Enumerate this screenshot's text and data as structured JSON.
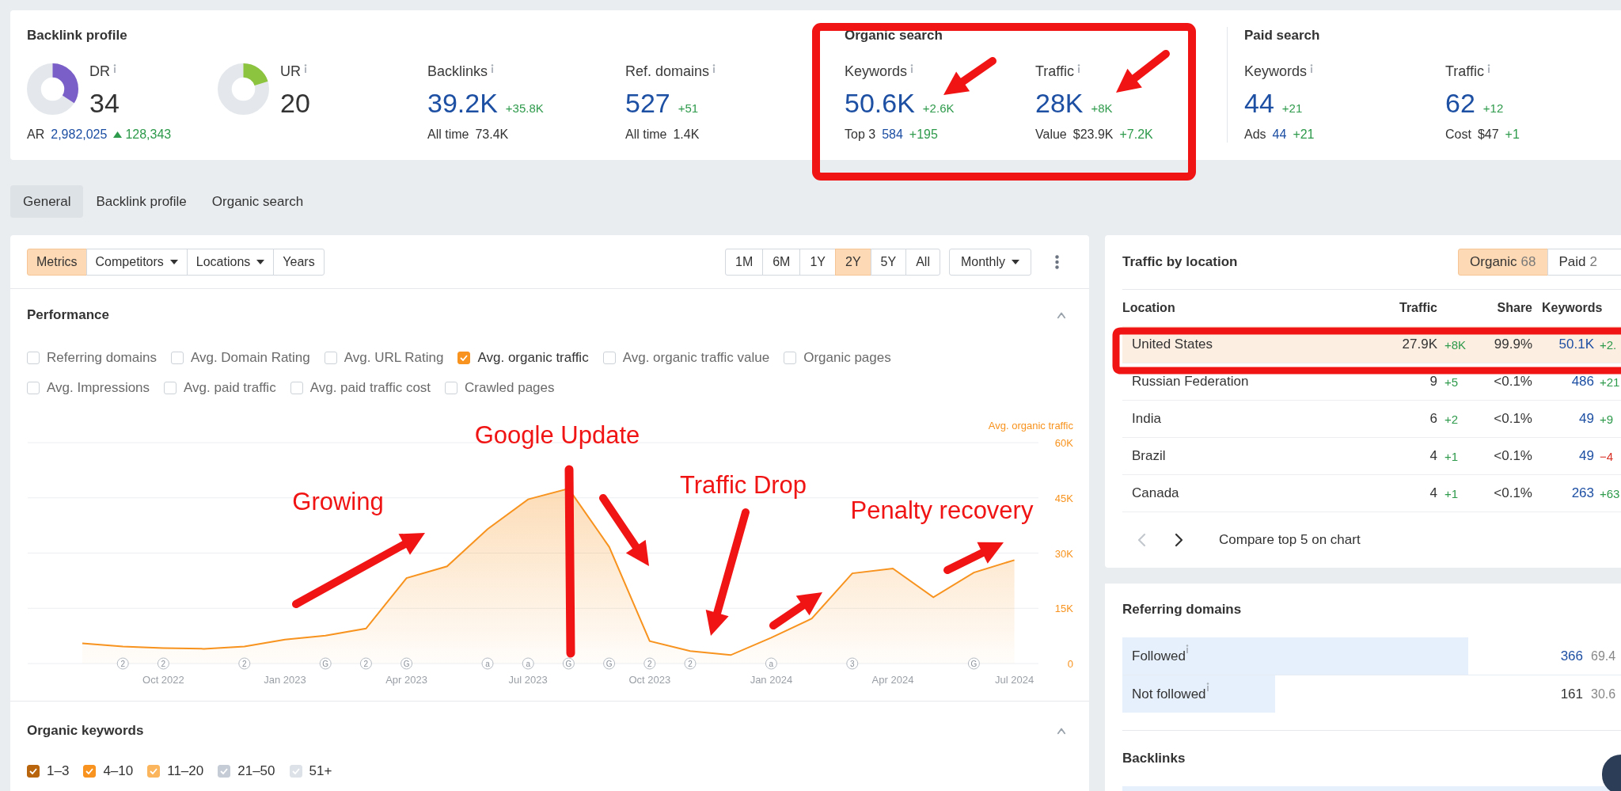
{
  "overview": [
    {
      "title": "Backlink profile",
      "metrics": [
        {
          "kind": "donut",
          "label": "DR",
          "value": "34",
          "level": 0.34,
          "color": "#7b5fc9",
          "sub": [
            {
              "kind": "label",
              "text": "AR"
            },
            {
              "kind": "link",
              "text": "2,982,025"
            },
            {
              "kind": "up",
              "text": "128,343"
            }
          ]
        },
        {
          "kind": "donut",
          "label": "UR",
          "value": "20",
          "level": 0.2,
          "color": "#8cc43f"
        },
        {
          "kind": "plain",
          "label": "Backlinks",
          "value": "39.2K",
          "delta": "+35.8K",
          "sub": [
            {
              "kind": "label",
              "text": "All time"
            },
            {
              "kind": "plain",
              "text": "73.4K"
            }
          ]
        },
        {
          "kind": "plain",
          "label": "Ref. domains",
          "value": "527",
          "delta": "+51",
          "sub": [
            {
              "kind": "label",
              "text": "All time"
            },
            {
              "kind": "plain",
              "text": "1.4K"
            }
          ]
        }
      ]
    },
    {
      "title": "Organic search",
      "metrics": [
        {
          "kind": "plain",
          "label": "Keywords",
          "value": "50.6K",
          "delta": "+2.6K",
          "sub": [
            {
              "kind": "label",
              "text": "Top 3"
            },
            {
              "kind": "link",
              "text": "584"
            },
            {
              "kind": "delta",
              "text": "+195"
            }
          ]
        },
        {
          "kind": "plain",
          "label": "Traffic",
          "value": "28K",
          "delta": "+8K",
          "sub": [
            {
              "kind": "label",
              "text": "Value"
            },
            {
              "kind": "plain",
              "text": "$23.9K"
            },
            {
              "kind": "delta",
              "text": "+7.2K"
            }
          ]
        }
      ]
    },
    {
      "title": "Paid search",
      "metrics": [
        {
          "kind": "plain",
          "label": "Keywords",
          "value": "44",
          "delta": "+21",
          "sub": [
            {
              "kind": "label",
              "text": "Ads"
            },
            {
              "kind": "link",
              "text": "44"
            },
            {
              "kind": "delta",
              "text": "+21"
            }
          ]
        },
        {
          "kind": "plain",
          "label": "Traffic",
          "value": "62",
          "delta": "+12",
          "sub": [
            {
              "kind": "label",
              "text": "Cost"
            },
            {
              "kind": "plain",
              "text": "$47"
            },
            {
              "kind": "delta",
              "text": "+1"
            }
          ]
        }
      ]
    }
  ],
  "tabs": [
    {
      "label": "General",
      "selected": true
    },
    {
      "label": "Backlink profile",
      "selected": false
    },
    {
      "label": "Organic search",
      "selected": false
    }
  ],
  "chart_panel": {
    "view_buttons": [
      {
        "label": "Metrics",
        "selected": true,
        "dropdown": false
      },
      {
        "label": "Competitors",
        "selected": false,
        "dropdown": true
      },
      {
        "label": "Locations",
        "selected": false,
        "dropdown": true
      },
      {
        "label": "Years",
        "selected": false,
        "dropdown": false
      }
    ],
    "periods": [
      {
        "label": "1M",
        "selected": false
      },
      {
        "label": "6M",
        "selected": false
      },
      {
        "label": "1Y",
        "selected": false
      },
      {
        "label": "2Y",
        "selected": true
      },
      {
        "label": "5Y",
        "selected": false
      },
      {
        "label": "All",
        "selected": false
      }
    ],
    "interval": "Monthly",
    "performance": {
      "title": "Performance",
      "metrics": [
        {
          "label": "Referring domains",
          "checked": false
        },
        {
          "label": "Avg. Domain Rating",
          "checked": false
        },
        {
          "label": "Avg. URL Rating",
          "checked": false
        },
        {
          "label": "Avg. organic traffic",
          "checked": true
        },
        {
          "label": "Avg. organic traffic value",
          "checked": false
        },
        {
          "label": "Organic pages",
          "checked": false
        },
        {
          "label": "Avg. Impressions",
          "checked": false
        },
        {
          "label": "Avg. paid traffic",
          "checked": false
        },
        {
          "label": "Avg. paid traffic cost",
          "checked": false
        },
        {
          "label": "Crawled pages",
          "checked": false
        }
      ],
      "chart_data": {
        "type": "area",
        "categories": [
          null,
          null,
          "Oct 2022",
          null,
          null,
          "Jan 2023",
          null,
          null,
          "Apr 2023",
          null,
          null,
          "Jul 2023",
          null,
          null,
          "Oct 2023",
          null,
          null,
          "Jan 2024",
          null,
          null,
          "Apr 2024",
          null,
          null,
          "Jul 2024"
        ],
        "grid": true,
        "series": [
          {
            "name": "Avg. organic traffic",
            "color": "#f7931e",
            "values": [
              5500,
              4600,
              4200,
              4000,
              4600,
              6500,
              7600,
              9500,
              23200,
              26400,
              36500,
              44600,
              47500,
              31700,
              6100,
              3400,
              2300,
              7000,
              12200,
              24500,
              25800,
              18000,
              24700,
              28100
            ]
          }
        ],
        "ylim": [
          0,
          60000
        ],
        "yticks": [
          {
            "value": 0,
            "label": "0"
          },
          {
            "value": 15000,
            "label": "15K"
          },
          {
            "value": 30000,
            "label": "30K"
          },
          {
            "value": 45000,
            "label": "45K"
          },
          {
            "value": 60000,
            "label": "60K"
          }
        ]
      },
      "event_markers": [
        "2",
        "2",
        "2",
        "G",
        "2",
        "G",
        "a",
        "a",
        "G",
        "G",
        "2",
        "2",
        "a",
        "3",
        "G"
      ]
    },
    "organic_keywords": {
      "title": "Organic keywords",
      "positions": [
        {
          "label": "1–3",
          "checked": true,
          "color": "#b8650e"
        },
        {
          "label": "4–10",
          "checked": true,
          "color": "#f7931e"
        },
        {
          "label": "11–20",
          "checked": true,
          "color": "#fbb55c"
        },
        {
          "label": "21–50",
          "checked": true,
          "color": "#c5ccd6"
        },
        {
          "label": "51+",
          "checked": true,
          "color": "#dde2e8"
        }
      ]
    }
  },
  "traffic_by_location": {
    "title": "Traffic by location",
    "toggle": [
      {
        "label": "Organic",
        "count": "68",
        "selected": true
      },
      {
        "label": "Paid",
        "count": "2",
        "selected": false
      }
    ],
    "columns": [
      "Location",
      "Traffic",
      "Share",
      "Keywords"
    ],
    "rows": [
      {
        "location": "United States",
        "traffic": "27.9K",
        "traffic_change": {
          "text": "+8K",
          "negative": false
        },
        "share": "99.9%",
        "keywords": "50.1K",
        "keywords_change": {
          "text": "+2.",
          "negative": false
        },
        "highlighted": true
      },
      {
        "location": "Russian Federation",
        "traffic": "9",
        "traffic_change": {
          "text": "+5",
          "negative": false
        },
        "share": "<0.1%",
        "keywords": "486",
        "keywords_change": {
          "text": "+21",
          "negative": false
        },
        "highlighted": false
      },
      {
        "location": "India",
        "traffic": "6",
        "traffic_change": {
          "text": "+2",
          "negative": false
        },
        "share": "<0.1%",
        "keywords": "49",
        "keywords_change": {
          "text": "+9",
          "negative": false
        },
        "highlighted": false
      },
      {
        "location": "Brazil",
        "traffic": "4",
        "traffic_change": {
          "text": "+1",
          "negative": false
        },
        "share": "<0.1%",
        "keywords": "49",
        "keywords_change": {
          "text": "−4",
          "negative": true
        },
        "highlighted": false
      },
      {
        "location": "Canada",
        "traffic": "4",
        "traffic_change": {
          "text": "+1",
          "negative": false
        },
        "share": "<0.1%",
        "keywords": "263",
        "keywords_change": {
          "text": "+63",
          "negative": false
        },
        "highlighted": false
      }
    ],
    "previous_disabled": true,
    "compare_link": "Compare top 5 on chart"
  },
  "referring_domains": {
    "title": "Referring domains",
    "rows": [
      {
        "label": "Followed",
        "count": "366",
        "share": "69.4",
        "level": 0.694,
        "link": true
      },
      {
        "label": "Not followed",
        "count": "161",
        "share": "30.6",
        "level": 0.306,
        "link": false
      }
    ]
  },
  "backlinks": {
    "title": "Backlinks"
  },
  "markup": {
    "texts": [
      "Google Update",
      "Growing",
      "Traffic Drop",
      "Penalty recovery"
    ]
  }
}
